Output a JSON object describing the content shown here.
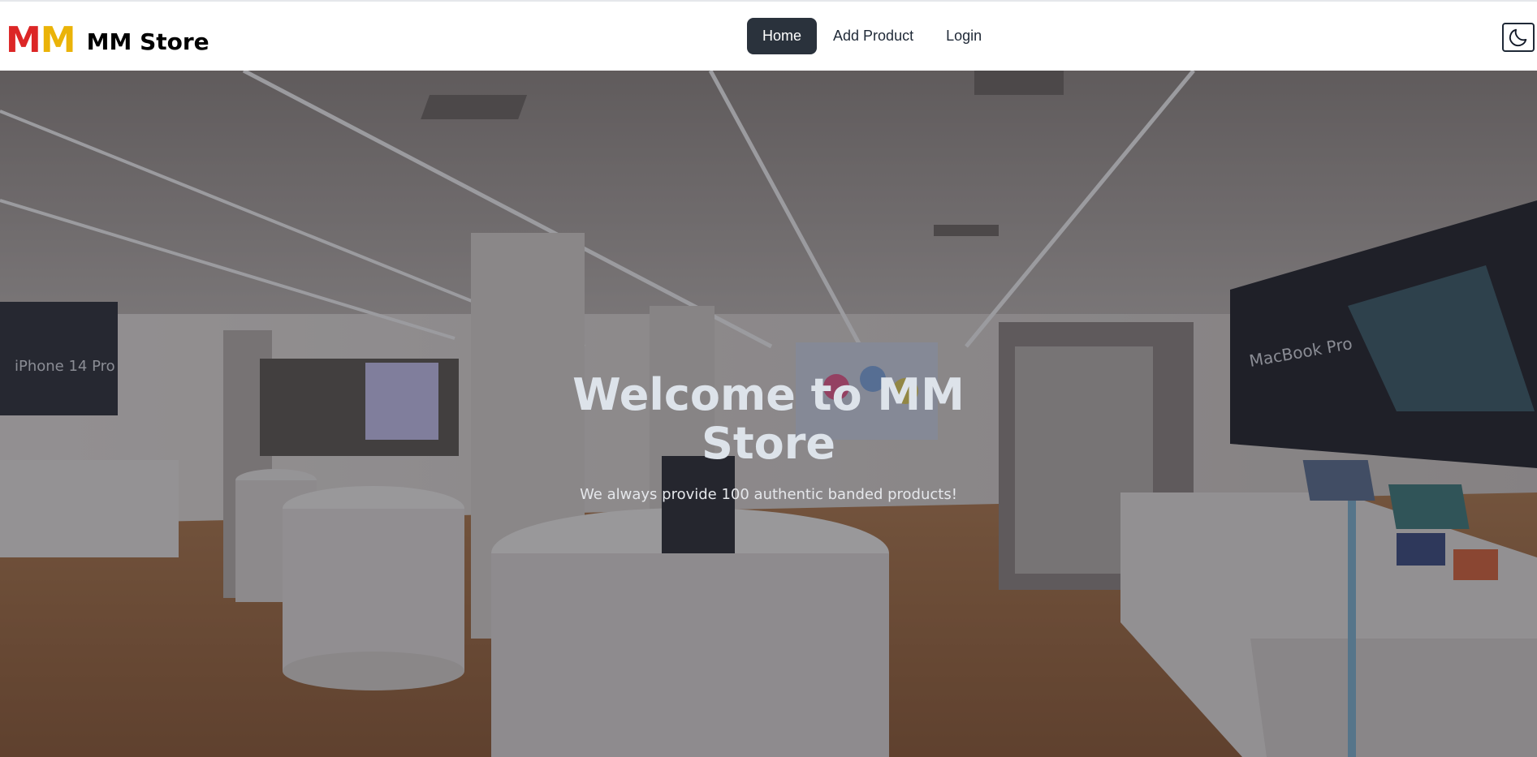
{
  "brand": {
    "logo_letter_1": "M",
    "logo_letter_2": "M",
    "name": "MM Store",
    "logo_colors": [
      "#dc2626",
      "#eab308"
    ]
  },
  "nav": {
    "items": [
      {
        "label": "Home",
        "active": true
      },
      {
        "label": "Add Product",
        "active": false
      },
      {
        "label": "Login",
        "active": false
      }
    ],
    "active_color": "#2a323c"
  },
  "theme_toggle": {
    "icon": "moon-icon"
  },
  "hero": {
    "title": "Welcome to MM Store",
    "subtitle": "We always provide 100 authentic banded products!",
    "background": "apple-store-interior-photo",
    "signs": {
      "left_screen": "iPhone 14 Pro",
      "right_screen": "MacBook Pro"
    }
  }
}
